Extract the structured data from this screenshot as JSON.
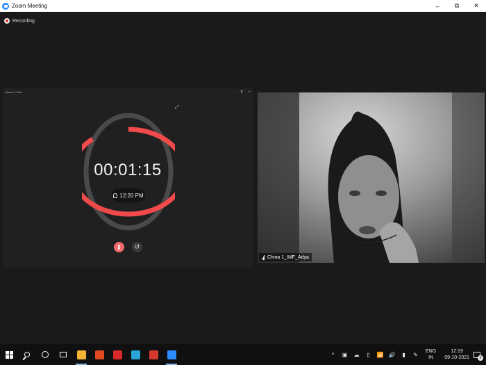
{
  "window": {
    "title": "Zoom Meeting",
    "buttons": {
      "minimize": "–",
      "maximize": "⧉",
      "close": "✕"
    },
    "bg_color": "#1a1a1a"
  },
  "recording": {
    "label": "Recording",
    "color": "#e0322c"
  },
  "shared_screen": {
    "app_title": "Alarms & Clock",
    "window_buttons": [
      "–",
      "⧉",
      "✕"
    ],
    "timer": {
      "elapsed": "00:01:15",
      "alarm_time": "12:20 PM",
      "progress": 0.88,
      "ring_color": "#f04a4a",
      "track_color": "#4a4a4a"
    },
    "controls": {
      "play_pause": "Ⅱ",
      "reset": "↺"
    }
  },
  "participant": {
    "name": "China 1_IMF_Adya"
  },
  "taskbar": {
    "apps": [
      {
        "name": "file-explorer-icon",
        "color": "#f3b234"
      },
      {
        "name": "office-icon",
        "color": "#e04a1f"
      },
      {
        "name": "app-v-icon",
        "color": "#d92a2a"
      },
      {
        "name": "edge-icon",
        "color": "#2aa3d8"
      },
      {
        "name": "wps-office-icon",
        "color": "#d6382c"
      },
      {
        "name": "zoom-icon",
        "color": "#2d8cff"
      }
    ],
    "tray_icons": [
      "^",
      "▣",
      "☁",
      "▯",
      "📶",
      "🔊",
      "▮",
      "✎"
    ],
    "language": {
      "line1": "ENG",
      "line2": "IN"
    },
    "clock": {
      "time": "12:19",
      "date": "09-10-2021"
    },
    "notification_count": "6"
  }
}
